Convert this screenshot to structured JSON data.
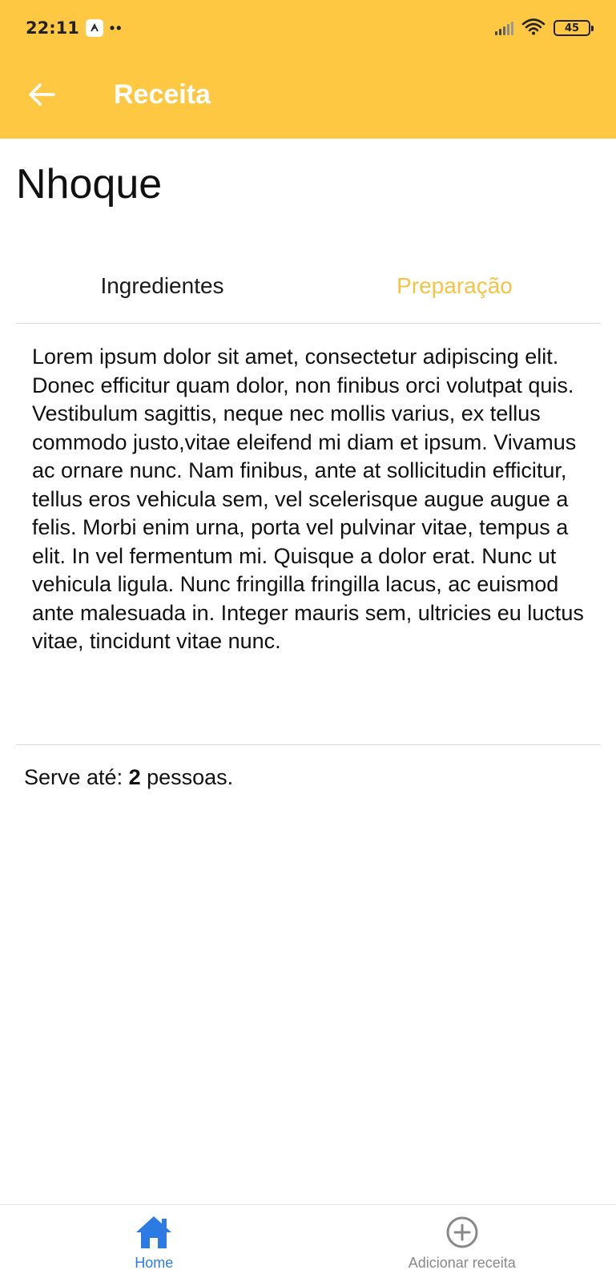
{
  "status_bar": {
    "time": "22:11",
    "battery": "45",
    "notification_icon": "app-notification-icon",
    "icons": [
      "signal-icon",
      "wifi-icon",
      "battery-icon"
    ]
  },
  "appbar": {
    "title": "Receita",
    "back_icon": "arrow-left-icon",
    "background_color": "#FFC843"
  },
  "recipe": {
    "name": "Nhoque",
    "tabs": [
      {
        "label": "Ingredientes",
        "active": false
      },
      {
        "label": "Preparação",
        "active": true
      }
    ],
    "body": "Lorem ipsum dolor sit amet, consectetur adipiscing elit. Donec efficitur quam dolor, non finibus orci volutpat quis. Vestibulum sagittis, neque nec mollis varius, ex tellus commodo justo,vitae eleifend mi diam et ipsum. Vivamus ac ornare nunc. Nam finibus, ante at sollicitudin efficitur, tellus eros vehicula sem, vel scelerisque augue augue a felis. Morbi enim urna, porta vel pulvinar vitae, tempus a elit. In vel fermentum mi. Quisque a dolor erat. Nunc ut vehicula ligula. Nunc fringilla fringilla lacus, ac euismod ante malesuada in. Integer mauris sem, ultricies eu luctus vitae, tincidunt vitae nunc.",
    "serves_prefix": "Serve até: ",
    "serves_count": "2",
    "serves_suffix": " pessoas."
  },
  "bottom_nav": [
    {
      "label": "Home",
      "icon": "home-icon",
      "active": true
    },
    {
      "label": "Adicionar receita",
      "icon": "add-circle-icon",
      "active": false
    }
  ],
  "colors": {
    "accent": "#FFC843",
    "active_tab": "#F6C445",
    "nav_active": "#2C7BE5",
    "nav_inactive": "#888888"
  }
}
